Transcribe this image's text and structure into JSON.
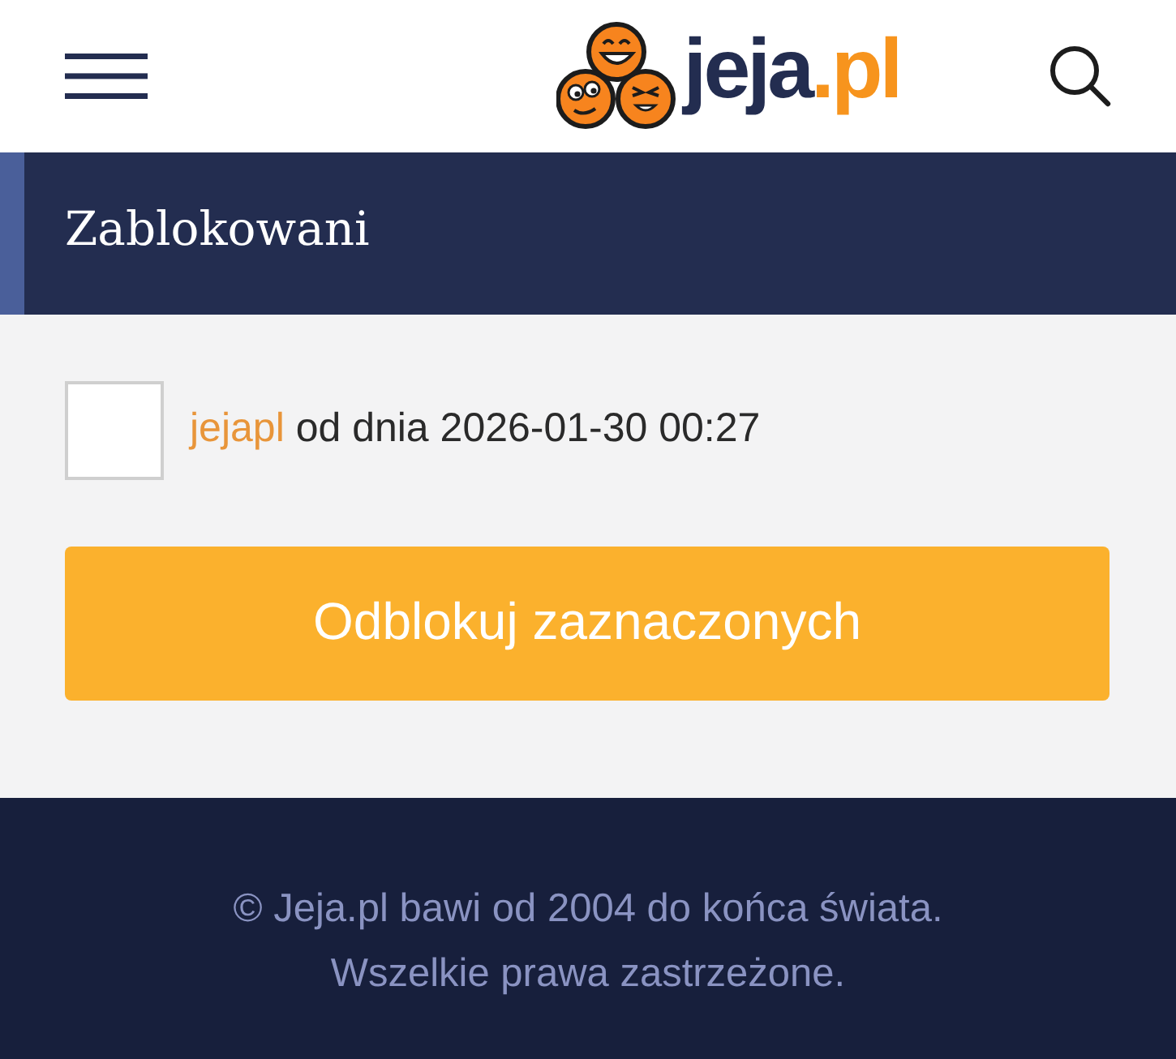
{
  "header": {
    "logo": {
      "name": "jeja",
      "suffix": ".pl"
    }
  },
  "section": {
    "title": "Zablokowani"
  },
  "blocked_users": [
    {
      "username": "jejapl",
      "since": "od dnia 2026-01-30 00:27",
      "checked": false
    }
  ],
  "unblock_button": {
    "label": "Odblokuj zaznaczonych"
  },
  "footer": {
    "lines": [
      "© Jeja.pl bawi od 2004 do końca świata.",
      "Wszelkie prawa zastrzeżone."
    ]
  }
}
